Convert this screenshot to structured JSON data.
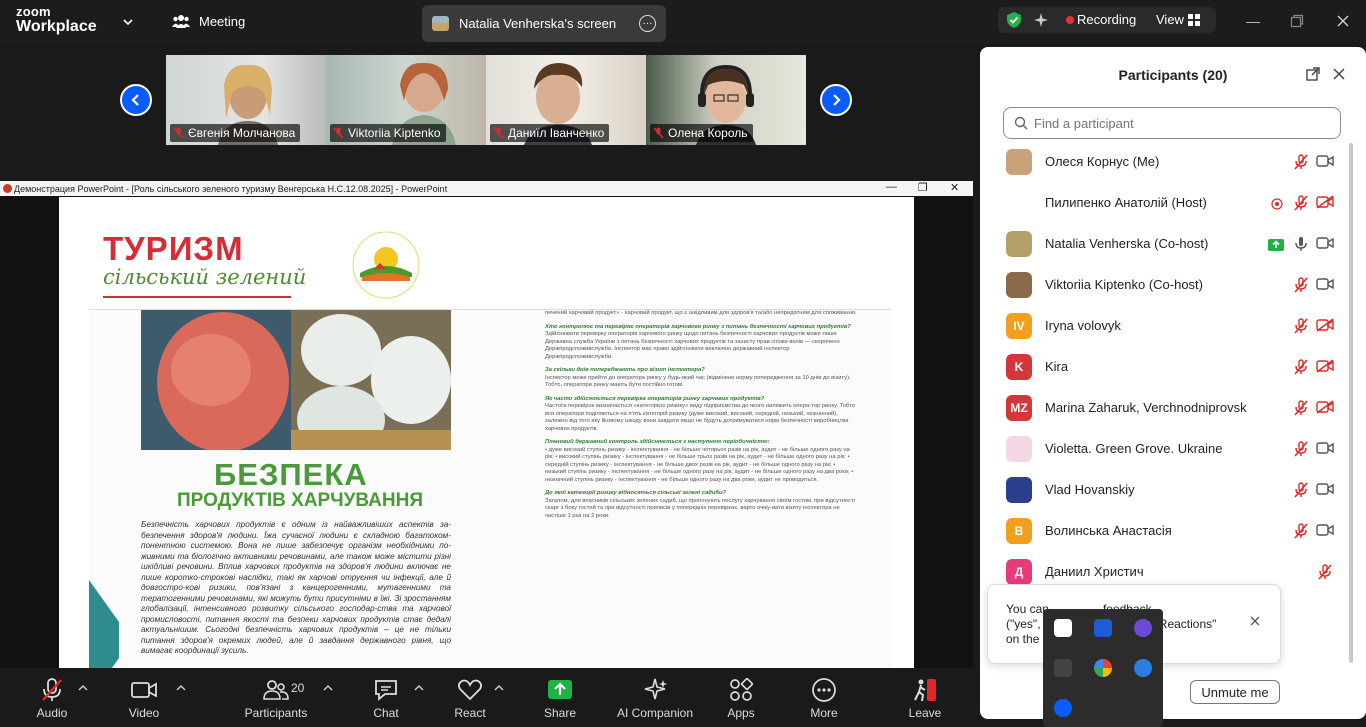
{
  "app": {
    "brand_top": "zoom",
    "brand_bottom": "Workplace"
  },
  "title_bar": {
    "meeting_label": "Meeting",
    "share_tab_label": "Natalia Venherska's screen",
    "share_tab_more": "···",
    "recording_label": "Recording",
    "view_label": "View"
  },
  "thumbnails": [
    {
      "name": "Євгенія Молчанова"
    },
    {
      "name": "Viktoriia Kiptenko"
    },
    {
      "name": "Даниїл Іванченко"
    },
    {
      "name": "Олена Король"
    }
  ],
  "shared_window": {
    "title": "Демонстрация PowerPoint - [Роль сільського зеленого  туризму  Венгерська Н.С.12.08.2025] - PowerPoint",
    "slide": {
      "title_red": "ТУРИЗМ",
      "title_green": "сільський зелений",
      "heading_big": "БЕЗПЕКА",
      "heading_sub": "ПРОДУКТІВ ХАРЧУВАННЯ",
      "body_left": "Безпечність харчових продуктів є одним із найважливіших аспектів за-безпечення здоров'я людини. Їжа сучасної людини є складною багатоком-понентною системою. Вона не лише забезпечує організм необхідними по-живними та біологічно активними речовинами, але також може містити різні шкідливі речовини. Вплив харчових продуктів на здоров'я людини включає не лише коротко-строкові наслідки, такі як харчові отруєння чи інфекції, але й довгостро-кові ризики, пов'язані з канцерогенними, мутагенними та тератогенними речовинами, які можуть бути присутніми в їжі. Зі зростанням глобалізації, інтенсивного розвитку сільського господар-ства та харчової промисловості, питання якості та безпеки харчових продуктів стає дедалі актуальнішим. Сьогодні безпечність харчових продуктів – це не тільки питання здоров'я окремих людей, але й завдання державного рівня, що вимагає координації зусиль.",
      "right_col": [
        {
          "type": "p",
          "text": "печений харчовий продукт» - харчовий продукт, що є шкідливим для здоров'я та/або непридатним для споживання."
        },
        {
          "type": "h",
          "text": "Хто контролює та перевіряє операторів харчового ринку з питань безпечності харчових продуктів?"
        },
        {
          "type": "p",
          "text": "Здійснювати перевірку операторів харчового ринку щодо питань безпечності харчових продуктів може лише Державна служба України з питань безпечності харчових продуктів та захисту прав спожи-вачів — скорочено Держпродспоживслужба. Інспектор має право здійснювати виключно державний інспектор Держпродспоживслужби."
        },
        {
          "type": "h",
          "text": "За скільки днів попереджають про візит інспектора?"
        },
        {
          "type": "p",
          "text": "Інспектор може прийти до оператора ринку у будь-який час (відмінено норму попередження за 10 днів до візиту). Тобто, оператори ринку мають бути постійно готові."
        },
        {
          "type": "h",
          "text": "Як часто здійснюється перевірка операторів ринку харчових продуктів?"
        },
        {
          "type": "p",
          "text": "Частота перевірок визначається «категорією ризику» виду підприємства до якого належить опера-тор ринку. Тобто вся оператори поділяються на п'ять категорій ризику (дуже високий, високий, середній, низький, незначний), залежно від того яку likовому шкоду вони завдати якщо не будуть дотримуватися норм безпечності виробництва харчових продуктів."
        },
        {
          "type": "h",
          "text": "Плановий державний контроль здійснюється з наступною періодичністю:"
        },
        {
          "type": "p",
          "text": "• дуже високий ступінь ризику - інспектування - не більше чотирьох разів на рік, аудит - не більше одного разу на рік; • високий ступінь ризику - інспектування - не більше трьох разів на рік, аудит - не більше одного разу на рік; • середній ступінь ризику - інспектування - не більше двох разів на рік, аудит - не більше одного разу на рік; • низький ступінь ризику - інспектування - не більше одного разу на рік, аудит - не більше одного разу на два роки; • незначний ступінь ризику - інспектування - не більше одного разу на два роки, аудит не проводиться."
        },
        {
          "type": "h",
          "text": "До якої категорії ризику відносяться сільські зелені садиби?"
        },
        {
          "type": "p",
          "text": "Загалом, для власників сільських зелених садиб, що пропонують послугу харчування своїм гостям, при відсутності скарг з боку гостей та при відсутності приписів у попередніх перевірках, варто очіку-вати візиту інспектора не частіше 1 раз на 2 роки."
        }
      ]
    }
  },
  "participants_panel": {
    "title": "Participants (20)",
    "search_placeholder": "Find a participant",
    "items": [
      {
        "name": "Олеся Корнус (Me)",
        "avatar_text": "",
        "avatar_color": "#c9a27a",
        "mic": "muted",
        "video": "on"
      },
      {
        "name": "Пилипенко Анатолій (Host)",
        "avatar_text": "",
        "avatar_color": "#ffffff",
        "mic": "muted",
        "video": "off",
        "extra": "record"
      },
      {
        "name": "Natalia Venherska (Co-host)",
        "avatar_text": "",
        "avatar_color": "#b5a06a",
        "mic": "on",
        "video": "on",
        "extra": "share"
      },
      {
        "name": "Viktoriia Kiptenko (Co-host)",
        "avatar_text": "",
        "avatar_color": "#8a6a4a",
        "mic": "muted",
        "video": "on"
      },
      {
        "name": "Iryna volovyk",
        "avatar_text": "IV",
        "avatar_color": "#f0a01e",
        "mic": "muted",
        "video": "off"
      },
      {
        "name": "Kira",
        "avatar_text": "K",
        "avatar_color": "#d4373a",
        "mic": "muted",
        "video": "off"
      },
      {
        "name": "Marina Zaharuk, Verchnodniprovsk",
        "avatar_text": "MZ",
        "avatar_color": "#d4373a",
        "mic": "muted",
        "video": "off"
      },
      {
        "name": "Violetta. Green Grove. Ukraine",
        "avatar_text": "",
        "avatar_color": "#f4d7e5",
        "mic": "muted",
        "video": "on"
      },
      {
        "name": "Vlad Hovanskiy",
        "avatar_text": "",
        "avatar_color": "#2b3f8c",
        "mic": "muted",
        "video": "on"
      },
      {
        "name": "Волинська Анастасія",
        "avatar_text": "В",
        "avatar_color": "#f0a01e",
        "mic": "muted",
        "video": "on"
      },
      {
        "name": "Даниил Христич",
        "avatar_text": "Д",
        "avatar_color": "#e83a7a",
        "mic": "muted",
        "video": "none"
      }
    ],
    "tooltip_text": "You ca…feedback (\"yes\", …n \"Reactions\" on the…",
    "tooltip_line1": "You can",
    "tooltip_line1b": "feedback",
    "tooltip_line2": "(\"yes\",",
    "tooltip_line2b": "\"Reactions\"",
    "tooltip_line3": "on the",
    "unmute_label": "Unmute me"
  },
  "toolbar": {
    "audio": "Audio",
    "video": "Video",
    "participants": "Participants",
    "participants_count": "20",
    "chat": "Chat",
    "react": "React",
    "share": "Share",
    "ai_companion": "AI Companion",
    "apps": "Apps",
    "more": "More",
    "leave": "Leave"
  },
  "colors": {
    "accent": "#0b5cff",
    "recording": "#e3352e",
    "muted": "#e02828",
    "share": "#1fb141"
  }
}
